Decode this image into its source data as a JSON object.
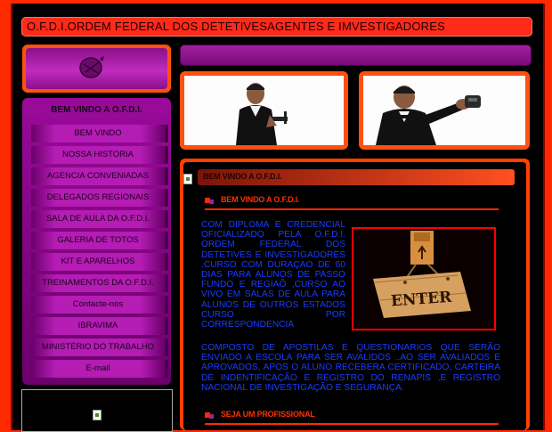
{
  "header": {
    "title": "O.F.D.I.ORDEM FEDERAL DOS DETETIVESAGENTES E IMVESTIGADORES"
  },
  "sidebar": {
    "title": "BEM VINDO A O.F.D.I.",
    "items": [
      {
        "label": "BEM VINDO"
      },
      {
        "label": "NOSSA HISTORIA"
      },
      {
        "label": "AGENCIA CONVENIADAS"
      },
      {
        "label": "DELEGADOS REGIONAIS"
      },
      {
        "label": "SALA DE AULA DA O.F.D.I."
      },
      {
        "label": "GALERIA DE TOTOS"
      },
      {
        "label": "KIT E APARELHOS"
      },
      {
        "label": "TREINAMENTOS DA O.F.D.I."
      },
      {
        "label": "Contacte-nos"
      },
      {
        "label": "IBRAVIMA"
      },
      {
        "label": "MINISTÉRIO DO TRABALHO"
      },
      {
        "label": "E-mail"
      }
    ]
  },
  "content": {
    "section_title": "BEM VINDO A O.F.D.I.",
    "sub_title": "BEM VINDO A O.F.D.I.",
    "body_left": "COM DIPLOMA E CREDENCIAL OFICIALIZADO PELA O.F.D.I. ORDEM FEDERAL DOS DETETIVES E INVESTIGADORES .CURSO COM DURAÇAO DE 60 DIAS PARA ALUNOS DE PASSO FUNDO E REGIAÕ ,CURSO AO VIVO EM SALAS DE AULA PARA ALUNOS DE OUTROS ESTADOS CURSO POR CORRESPONDENCIA",
    "body_full": "COMPOSTO DE APOSTILAS E QUESTIONARIOS QUE SERÃO ENVIADO A ESCOLA PARA SER AVALIDOS ..AO SER AVALIADOS E APROVADOS, APOS O ALUNO RECEBERA CERTIFICADO, CARTEIRA DE INDENTIFICAÇÃO E REGISTRO DO RENAPIS ,E REGISTRO NACIONAL DE INVESTIGAÇÃO E SEGURANÇA.",
    "enter_sign": "ENTER",
    "second_sub_title": "SEJA UM PROFISSIONAL"
  },
  "colors": {
    "page_bg": "#ff2a00",
    "frame_bg": "#000000",
    "menu_purple": "#b41cb4",
    "body_text": "#1a3cff"
  },
  "icons": [
    "emblem-icon",
    "broken-image-icon"
  ]
}
